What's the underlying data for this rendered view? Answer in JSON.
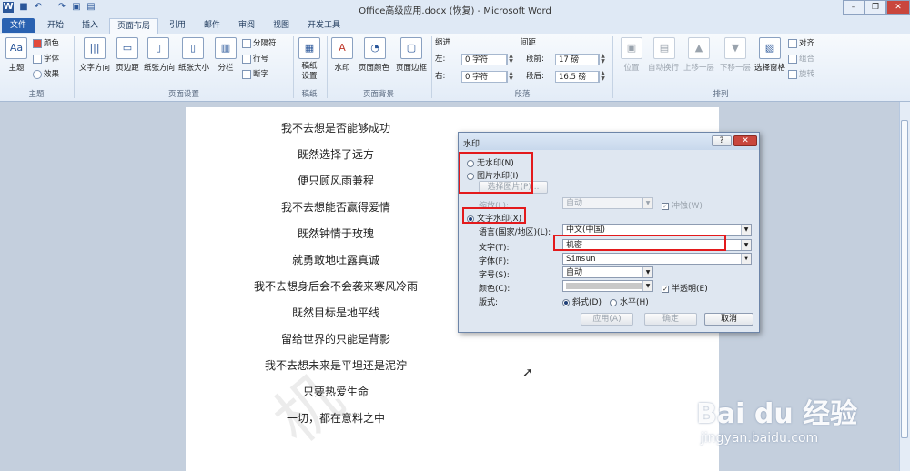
{
  "window": {
    "title": "Office高级应用.docx (恢复) - Microsoft Word",
    "app_icon": "W"
  },
  "tabs": [
    "文件",
    "开始",
    "插入",
    "页面布局",
    "引用",
    "邮件",
    "审阅",
    "视图",
    "开发工具"
  ],
  "active_tab": "页面布局",
  "ribbon": {
    "theme": {
      "group": "主题",
      "big": "主题",
      "colors": "颜色",
      "fonts": "字体",
      "effects": "效果"
    },
    "page_setup": {
      "group": "页面设置",
      "text_direction": "文字方向",
      "margins": "页边距",
      "orientation": "纸张方向",
      "size": "纸张大小",
      "columns": "分栏",
      "breaks": "分隔符",
      "line_numbers": "行号",
      "hyphenation": "断字"
    },
    "manuscript": {
      "group": "稿纸",
      "label": "稿纸\n设置"
    },
    "page_background": {
      "group": "页面背景",
      "watermark": "水印",
      "page_color": "页面颜色",
      "page_borders": "页面边框"
    },
    "paragraph": {
      "group": "段落",
      "indent": "缩进",
      "spacing": "间距",
      "left_label": "左:",
      "left_value": "0 字符",
      "right_label": "右:",
      "right_value": "0 字符",
      "before_label": "段前:",
      "before_value": "17 磅",
      "after_label": "段后:",
      "after_value": "16.5 磅"
    },
    "arrange": {
      "group": "排列",
      "position": "位置",
      "wrap": "自动换行",
      "forward": "上移一层",
      "backward": "下移一层",
      "selection": "选择窗格",
      "align": "对齐",
      "group_btn": "组合",
      "rotate": "旋转"
    }
  },
  "document": {
    "lines": [
      "我不去想是否能够成功",
      "既然选择了远方",
      "便只顾风雨兼程",
      "我不去想能否赢得爱情",
      "既然钟情于玫瑰",
      "就勇敢地吐露真诚",
      "我不去想身后会不会袭来寒风冷雨",
      "既然目标是地平线",
      "留给世界的只能是背影",
      "我不去想未来是平坦还是泥泞",
      "只要热爱生命",
      "一切，都在意料之中"
    ]
  },
  "dialog": {
    "title": "水印",
    "no_watermark": "无水印(N)",
    "picture_watermark": "图片水印(I)",
    "select_picture": "选择图片(P)...",
    "scale_label": "缩放(L):",
    "scale_value": "自动",
    "washout": "冲蚀(W)",
    "text_watermark": "文字水印(X)",
    "language_label": "语言(国家/地区)(L):",
    "language_value": "中文(中国)",
    "text_label": "文字(T):",
    "text_value": "机密",
    "font_label": "字体(F):",
    "font_value": "Simsun",
    "size_label": "字号(S):",
    "size_value": "自动",
    "color_label": "颜色(C):",
    "semitransparent": "半透明(E)",
    "layout_label": "版式:",
    "diagonal": "斜式(D)",
    "horizontal": "水平(H)",
    "apply": "应用(A)",
    "ok": "确定",
    "cancel": "取消",
    "help_icon": "?"
  },
  "watermark_preview": "机",
  "baidu": {
    "logo": "Bai du 经验",
    "url": "jingyan.baidu.com"
  },
  "colors": {
    "accent": "#2a62b1",
    "highlight": "#e31a1c"
  }
}
